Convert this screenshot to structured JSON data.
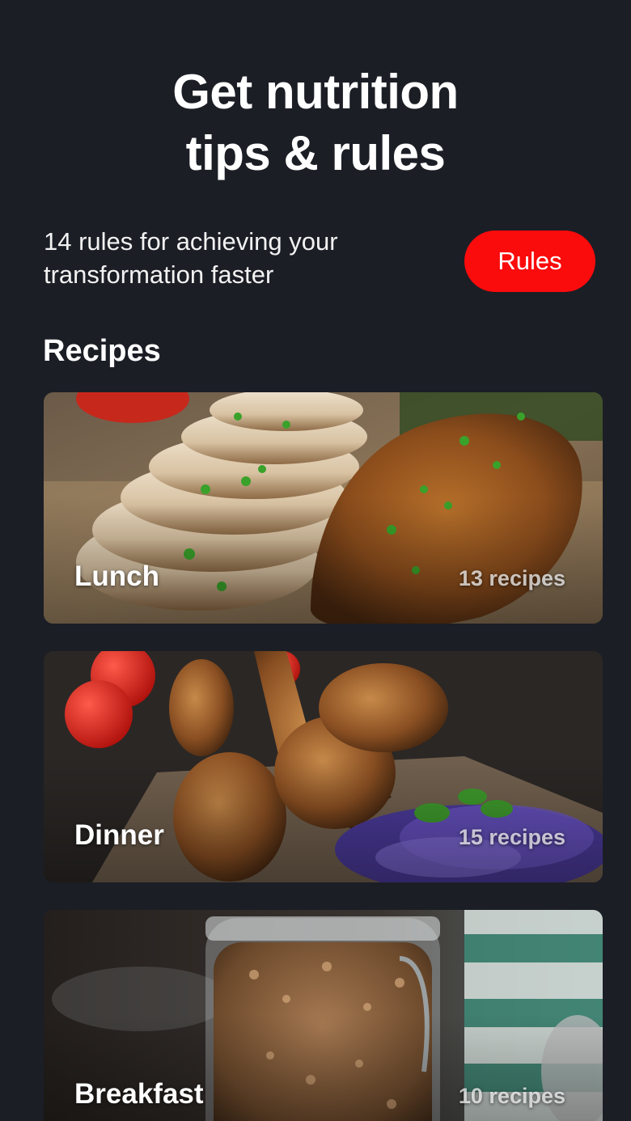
{
  "header": {
    "title_line1": "Get nutrition",
    "title_line2": "tips & rules"
  },
  "rules": {
    "description_line1": "14 rules for achieving your",
    "description_line2": "transformation faster",
    "button_label": "Rules"
  },
  "recipes": {
    "section_title": "Recipes",
    "cards": [
      {
        "title": "Lunch",
        "count": "13 recipes",
        "image_icon": "grilled-chicken-breast-photo"
      },
      {
        "title": "Dinner",
        "count": "15 recipes",
        "image_icon": "roasted-chicken-drumsticks-photo"
      },
      {
        "title": "Breakfast",
        "count": "10 recipes",
        "image_icon": "granola-jar-photo"
      }
    ]
  },
  "colors": {
    "background": "#1b1e25",
    "accent": "#fa0b0c",
    "text": "#ffffff"
  }
}
